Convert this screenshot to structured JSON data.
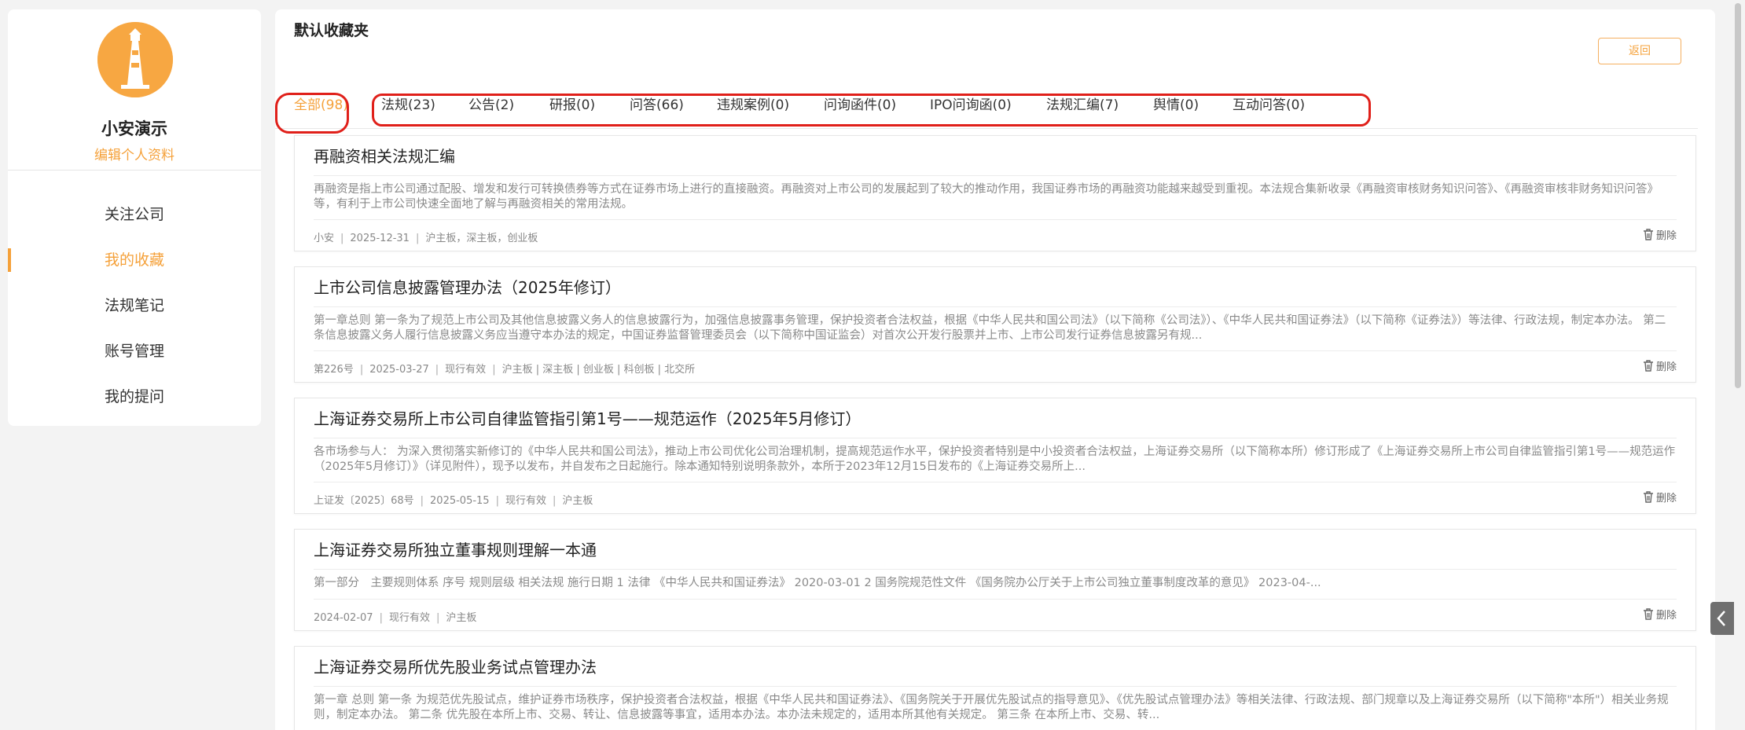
{
  "sidebar": {
    "username": "小安演示",
    "edit_profile": "编辑个人资料",
    "menu": [
      {
        "label": "关注公司"
      },
      {
        "label": "我的收藏"
      },
      {
        "label": "法规笔记"
      },
      {
        "label": "账号管理"
      },
      {
        "label": "我的提问"
      }
    ],
    "active_index": 1
  },
  "main": {
    "title": "默认收藏夹",
    "back_label": "返回",
    "tabs": [
      {
        "label": "全部(98)"
      },
      {
        "label": "法规(23)"
      },
      {
        "label": "公告(2)"
      },
      {
        "label": "研报(0)"
      },
      {
        "label": "问答(66)"
      },
      {
        "label": "违规案例(0)"
      },
      {
        "label": "问询函件(0)"
      },
      {
        "label": "IPO问询函(0)"
      },
      {
        "label": "法规汇编(7)"
      },
      {
        "label": "舆情(0)"
      },
      {
        "label": "互动问答(0)"
      }
    ],
    "active_tab": 0,
    "delete_label": "删除",
    "cards": [
      {
        "title": "再融资相关法规汇编",
        "summary": "再融资是指上市公司通过配股、增发和发行可转换债券等方式在证券市场上进行的直接融资。再融资对上市公司的发展起到了较大的推动作用，我国证券市场的再融资功能越来越受到重视。本法规合集新收录《再融资审核财务知识问答》、《再融资审核非财务知识问答》等，有利于上市公司快速全面地了解与再融资相关的常用法规。",
        "meta": [
          "小安",
          "2025-12-31",
          "沪主板，深主板，创业板"
        ]
      },
      {
        "title": "上市公司信息披露管理办法（2025年修订）",
        "summary": "第一章总则 第一条为了规范上市公司及其他信息披露义务人的信息披露行为，加强信息披露事务管理，保护投资者合法权益，根据《中华人民共和国公司法》（以下简称《公司法》）、《中华人民共和国证券法》（以下简称《证券法》）等法律、行政法规，制定本办法。 第二条信息披露义务人履行信息披露义务应当遵守本办法的规定，中国证券监督管理委员会（以下简称中国证监会）对首次公开发行股票并上市、上市公司发行证券信息披露另有规...",
        "meta": [
          "第226号",
          "2025-03-27",
          "现行有效",
          "沪主板 | 深主板 | 创业板 | 科创板 | 北交所"
        ]
      },
      {
        "title": "上海证券交易所上市公司自律监管指引第1号——规范运作（2025年5月修订）",
        "summary": "各市场参与人： 为深入贯彻落实新修订的《中华人民共和国公司法》，推动上市公司优化公司治理机制，提高规范运作水平，保护投资者特别是中小投资者合法权益，上海证券交易所（以下简称本所）修订形成了《上海证券交易所上市公司自律监管指引第1号——规范运作（2025年5月修订）》（详见附件），现予以发布，并自发布之日起施行。除本通知特别说明条款外，本所于2023年12月15日发布的《上海证券交易所上...",
        "meta": [
          "上证发〔2025〕68号",
          "2025-05-15",
          "现行有效",
          "沪主板"
        ]
      },
      {
        "title": "上海证券交易所独立董事规则理解一本通",
        "summary": "第一部分　主要规则体系 序号 规则层级 相关法规 施行日期 1 法律 《中华人民共和国证券法》 2020-03-01 2 国务院规范性文件 《国务院办公厅关于上市公司独立董事制度改革的意见》 2023-04-...",
        "meta": [
          "2024-02-07",
          "现行有效",
          "沪主板"
        ]
      },
      {
        "title": "上海证券交易所优先股业务试点管理办法",
        "summary": "第一章 总则 第一条 为规范优先股试点，维护证券市场秩序，保护投资者合法权益，根据《中华人民共和国证券法》、《国务院关于开展优先股试点的指导意见》、《优先股试点管理办法》等相关法律、行政法规、部门规章以及上海证券交易所（以下简称\"本所\"）相关业务规则，制定本办法。 第二条 优先股在本所上市、交易、转让、信息披露等事宜，适用本办法。本办法未规定的，适用本所其他有关规定。 第三条 在本所上市、交易、转...",
        "meta": []
      }
    ]
  },
  "colors": {
    "accent": "#f5a13a",
    "highlight": "#e0201a"
  },
  "icons": {
    "avatar": "lighthouse-logo",
    "delete": "trash-icon",
    "collapse": "chevron-left-icon"
  }
}
